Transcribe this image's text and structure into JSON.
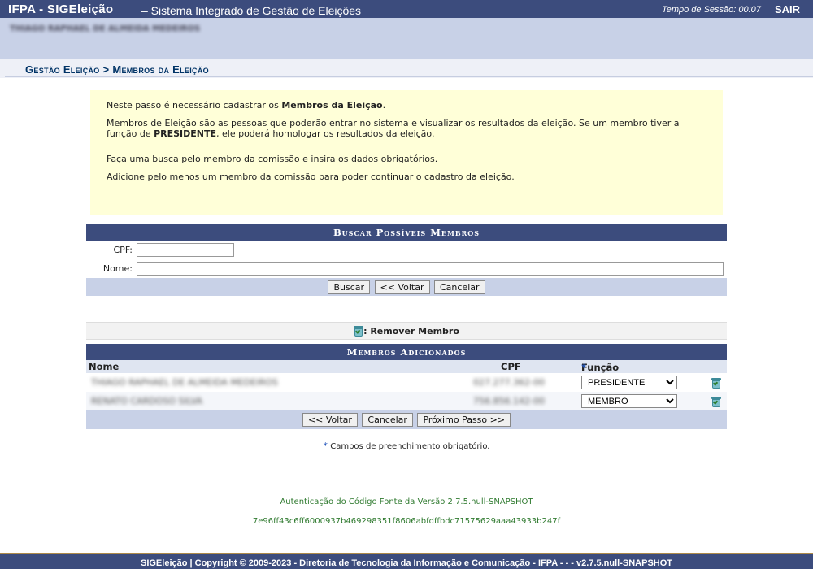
{
  "topbar": {
    "system_name": "IFPA - SIGEleição",
    "subtitle": "– Sistema Integrado de Gestão de Eleições",
    "session_time": "Tempo de Sessão: 00:07",
    "logout": "SAIR"
  },
  "user": {
    "name": "THIAGO RAPHAEL DE ALMEIDA MEDEIROS"
  },
  "breadcrumb": {
    "title": "Gestão Eleição > Membros da Eleição"
  },
  "info": {
    "p1_prefix": "Neste passo é necessário cadastrar os ",
    "p1_bold": "Membros da Eleição",
    "p1_suffix": ".",
    "p2_prefix": "Membros de Eleição são as pessoas que poderão entrar no sistema e visualizar os resultados da eleição. Se um membro tiver a função de ",
    "p2_bold": "PRESIDENTE",
    "p2_suffix": ", ele poderá homologar os resultados da eleição.",
    "p3": "Faça uma busca pelo membro da comissão e insira os dados obrigatórios.",
    "p4": "Adicione pelo menos um membro da comissão para poder continuar o cadastro da eleição."
  },
  "search": {
    "header": "Buscar Possíveis Membros",
    "cpf_label": "CPF:",
    "cpf_value": "",
    "nome_label": "Nome:",
    "nome_value": "",
    "buttons": {
      "buscar": "Buscar",
      "voltar": "<< Voltar",
      "cancelar": "Cancelar"
    }
  },
  "legend": {
    "remove_label": ": Remover Membro"
  },
  "members": {
    "header": "Membros Adicionados",
    "columns": {
      "nome": "Nome",
      "cpf": "CPF",
      "funcao": "Função"
    },
    "rows": [
      {
        "nome": "THIAGO RAPHAEL DE ALMEIDA MEDEIROS",
        "cpf": "027.277.362-00",
        "funcao": "PRESIDENTE"
      },
      {
        "nome": "RENATO CARDOSO SILVA",
        "cpf": "756.856.142-00",
        "funcao": "MEMBRO"
      }
    ],
    "buttons": {
      "voltar": "<< Voltar",
      "cancelar": "Cancelar",
      "proximo": "Próximo Passo >>"
    }
  },
  "required_note": "Campos de preenchimento obrigatório.",
  "auth_text": "Autenticação do Código Fonte da Versão 2.7.5.null-SNAPSHOT",
  "auth_hash": "7e96ff43c6ff6000937b469298351f8606abfdffbdc71575629aaa43933b247f",
  "footer": "SIGEleição | Copyright © 2009-2023 - Diretoria de Tecnologia da Informação e Comunicação - IFPA - - - v2.7.5.null-SNAPSHOT",
  "colors": {
    "bar": "#3c4c7d",
    "band": "#c8d1e7",
    "info_bg": "#ffffd8",
    "link_green": "#2f7a2f"
  },
  "icons": {
    "remove": "trash-icon",
    "required": "asterisk-icon"
  }
}
